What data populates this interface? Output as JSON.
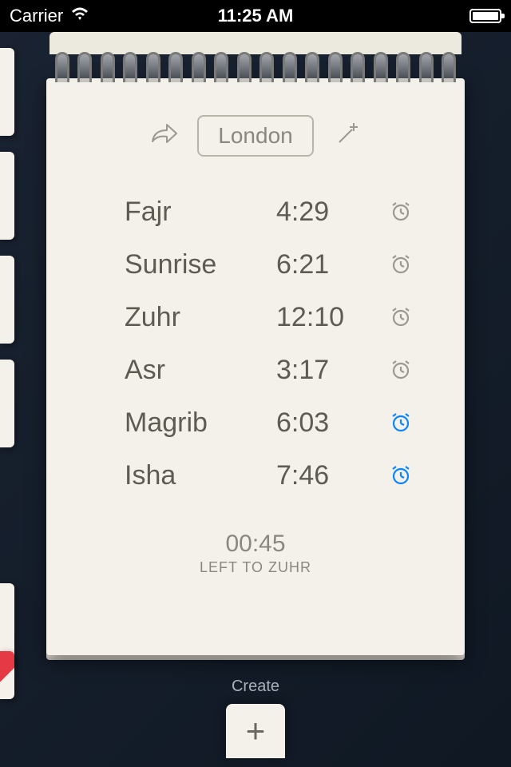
{
  "status": {
    "carrier": "Carrier",
    "time": "11:25 AM"
  },
  "header": {
    "location": "London"
  },
  "prayers": [
    {
      "name": "Fajr",
      "time": "4:29",
      "alarm": false
    },
    {
      "name": "Sunrise",
      "time": "6:21",
      "alarm": false
    },
    {
      "name": "Zuhr",
      "time": "12:10",
      "alarm": false
    },
    {
      "name": "Asr",
      "time": "3:17",
      "alarm": false
    },
    {
      "name": "Magrib",
      "time": "6:03",
      "alarm": true
    },
    {
      "name": "Isha",
      "time": "7:46",
      "alarm": true
    }
  ],
  "countdown": {
    "time": "00:45",
    "label": "LEFT TO ZUHR"
  },
  "bottom": {
    "create_label": "Create"
  }
}
